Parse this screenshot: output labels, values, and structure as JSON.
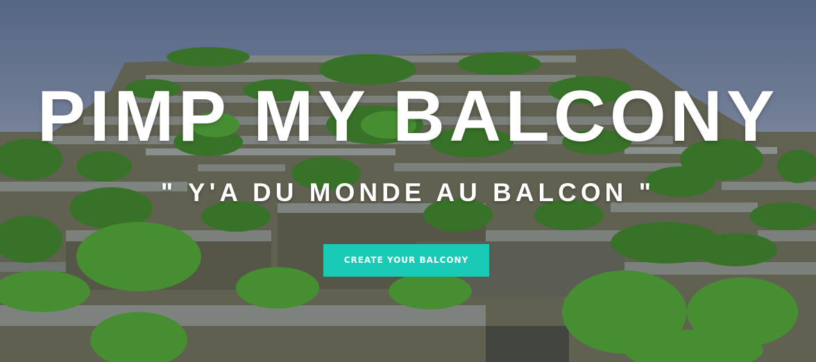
{
  "hero": {
    "title": "PIMP MY BALCONY",
    "subtitle": "\" Y'A DU MONDE AU BALCON \"",
    "cta_label": "CREATE YOUR BALCONY"
  },
  "colors": {
    "cta_background": "#19cbb6",
    "text": "#ffffff",
    "sky": "#6f7f9d",
    "facade": "#6b6c58",
    "greenery": "#3f8a2e"
  }
}
